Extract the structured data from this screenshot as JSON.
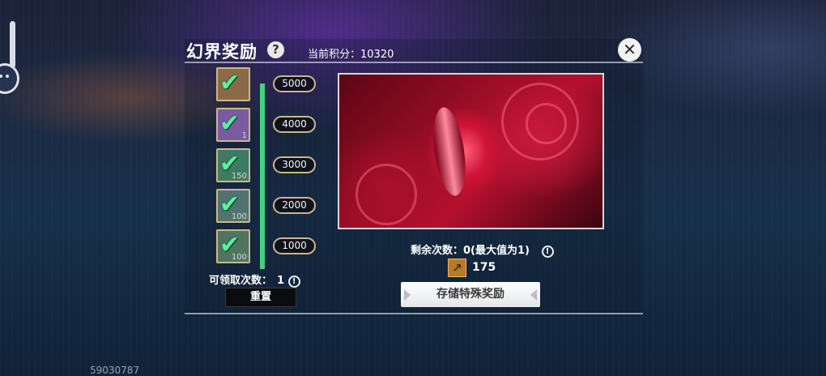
{
  "header": {
    "title": "幻界奖励",
    "score_label": "当前积分：",
    "score_value": "10320"
  },
  "rewards": [
    {
      "threshold": "5000",
      "qty": "",
      "claimed": true,
      "bg": "#8a6a48"
    },
    {
      "threshold": "4000",
      "qty": "1",
      "claimed": true,
      "bg": "#7a5aa0"
    },
    {
      "threshold": "3000",
      "qty": "150",
      "claimed": true,
      "bg": "#3f7a62"
    },
    {
      "threshold": "2000",
      "qty": "100",
      "claimed": true,
      "bg": "#4f7470"
    },
    {
      "threshold": "1000",
      "qty": "100",
      "claimed": true,
      "bg": "#4f7460"
    }
  ],
  "claims": {
    "label": "可领取次数：",
    "value": "1"
  },
  "reset_label": "重置",
  "special": {
    "remaining": "剩余次数：0(最大值为1)",
    "currency_amount": "175",
    "store_label": "存储特殊奖励"
  },
  "uid": "59030787",
  "icons": {
    "help": "?",
    "info": "!",
    "close": "✕",
    "check": "✔"
  },
  "colors": {
    "track": "#44d27a",
    "check": "#5cf0a0",
    "pill_border": "#cbb68a"
  }
}
